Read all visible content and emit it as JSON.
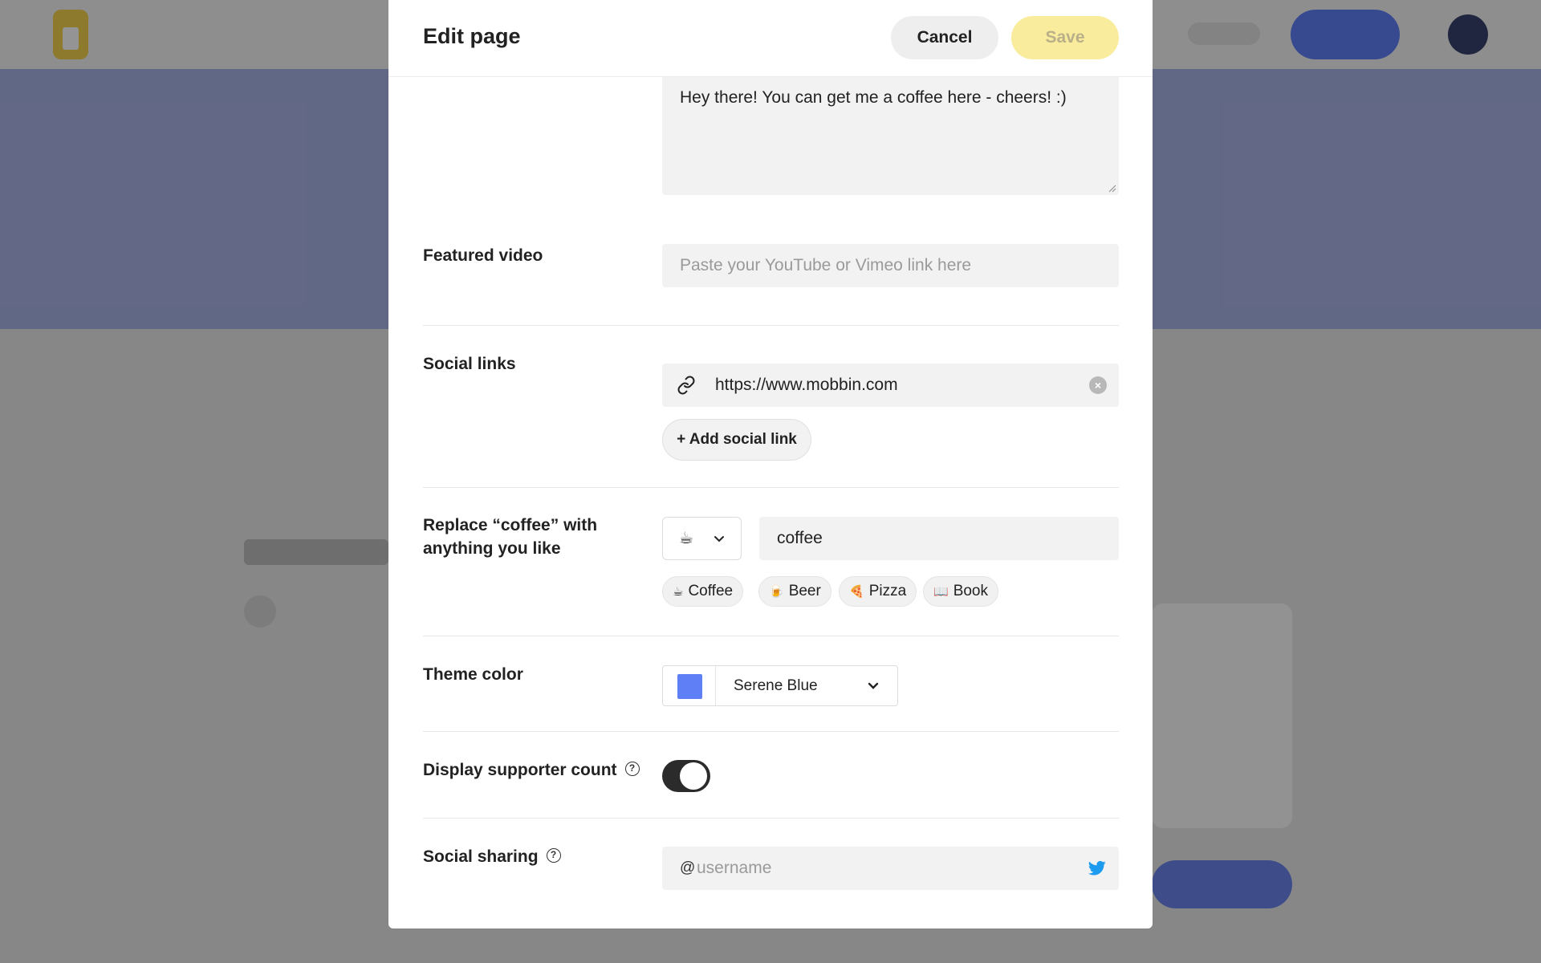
{
  "modal": {
    "title": "Edit page",
    "cancel_label": "Cancel",
    "save_label": "Save"
  },
  "about": {
    "value": "Hey there! You can get me a coffee here - cheers! :)"
  },
  "featured_video": {
    "label": "Featured video",
    "placeholder": "Paste your YouTube or Vimeo link here"
  },
  "social_links": {
    "label": "Social links",
    "url": "https://www.mobbin.com",
    "add_label": "+ Add social link"
  },
  "replace_coffee": {
    "label": "Replace “coffee” with anything you like",
    "selected_emoji": "☕",
    "value": "coffee",
    "chips": [
      {
        "emoji": "☕",
        "label": "Coffee"
      },
      {
        "emoji": "🍺",
        "label": "Beer"
      },
      {
        "emoji": "🍕",
        "label": "Pizza"
      },
      {
        "emoji": "📖",
        "label": "Book"
      }
    ]
  },
  "theme_color": {
    "label": "Theme color",
    "selected": "Serene Blue",
    "swatch": "#5f7ff6"
  },
  "supporter_count": {
    "label": "Display supporter count",
    "help_icon": "question-circle-icon",
    "enabled": true
  },
  "social_sharing": {
    "label": "Social sharing",
    "help_icon": "question-circle-icon",
    "at": "@",
    "placeholder": "username",
    "icon": "twitter-icon",
    "icon_color": "#1d9bf0"
  },
  "colors": {
    "save_disabled": "#f9ec9c",
    "toggle_on": "#2b2b2b"
  }
}
